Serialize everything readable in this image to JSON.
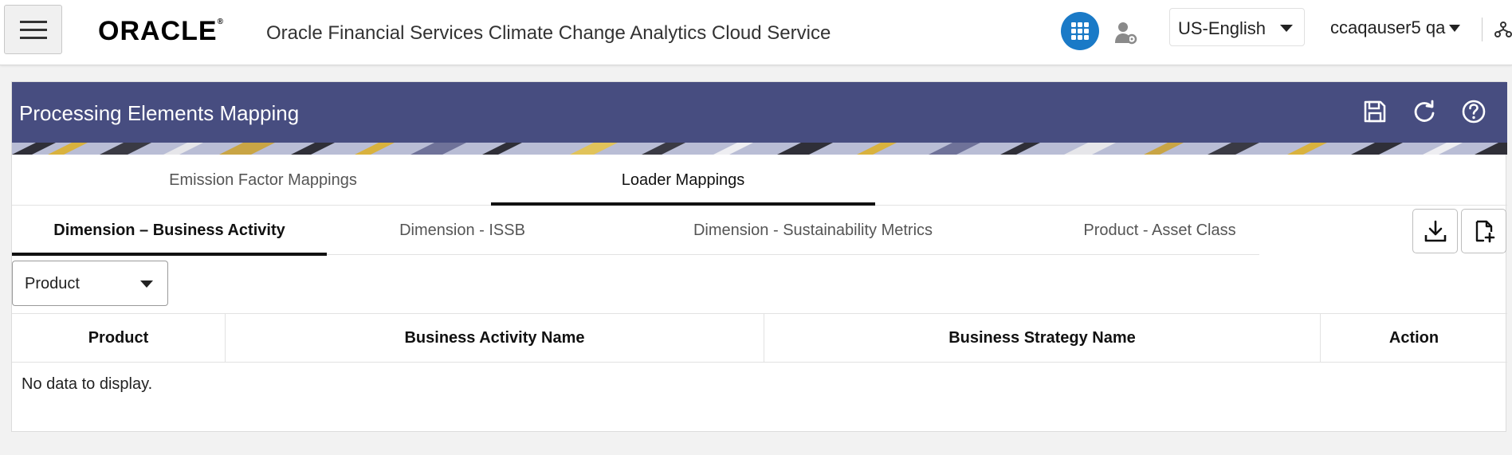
{
  "header": {
    "menu_label": "Menu",
    "brand": "ORACLE",
    "app_title": "Oracle Financial Services Climate Change Analytics Cloud Service",
    "language": "US-English",
    "user": "ccaqauser5 qa",
    "accent_color": "#1a7ac7",
    "icons": [
      "hamburger-icon",
      "apps-grid-icon",
      "user-admin-icon",
      "chevron-down-icon",
      "hierarchy-icon"
    ]
  },
  "panel": {
    "title": "Processing Elements Mapping",
    "header_color": "#474d80",
    "header_icons": [
      "save-icon",
      "refresh-icon",
      "help-icon"
    ]
  },
  "tabs_primary": [
    {
      "label": "Emission Factor Mappings",
      "active": false
    },
    {
      "label": "Loader Mappings",
      "active": true
    }
  ],
  "tabs_secondary": [
    {
      "label": "Dimension – Business Activity",
      "active": true
    },
    {
      "label": "Dimension - ISSB",
      "active": false
    },
    {
      "label": "Dimension - Sustainability Metrics",
      "active": false
    },
    {
      "label": "Product - Asset Class",
      "active": false
    }
  ],
  "actions": [
    "download-icon",
    "new-file-icon"
  ],
  "filter": {
    "value": "Product"
  },
  "table": {
    "columns": [
      "Product",
      "Business Activity Name",
      "Business Strategy Name",
      "Action"
    ],
    "rows": [],
    "empty_message": "No data to display."
  }
}
